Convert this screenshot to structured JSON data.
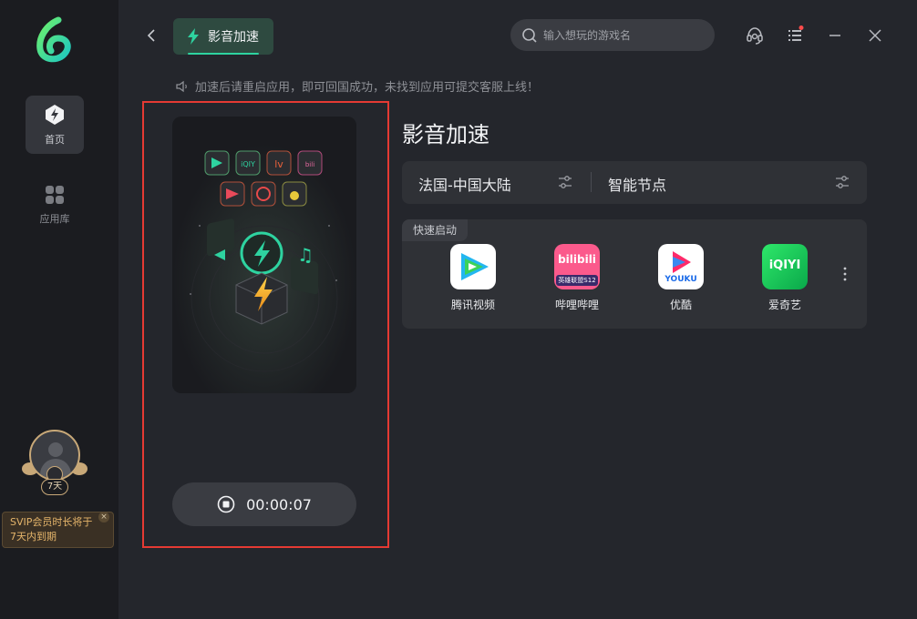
{
  "sidebar": {
    "items": [
      {
        "label": "首页",
        "icon": "lightning-home-icon",
        "active": true
      },
      {
        "label": "应用库",
        "icon": "grid-apps-icon",
        "active": false
      }
    ],
    "user": {
      "days_badge": "7天"
    },
    "vip_tip": {
      "line1": "SVIP会员时长将于",
      "line2": "7天内到期",
      "close": "×"
    }
  },
  "header": {
    "tab_label": "影音加速",
    "search_placeholder": "输入想玩的游戏名"
  },
  "notice": "加速后请重启应用，即可回国成功，未找到应用可提交客服上线！",
  "timer": "00:00:07",
  "main": {
    "title": "影音加速",
    "region": "法国-中国大陆",
    "node": "智能节点"
  },
  "quick_launch": {
    "tag": "快速启动",
    "apps": [
      {
        "name": "腾讯视频",
        "icon": "tencent-video-icon"
      },
      {
        "name": "哔哩哔哩",
        "icon": "bilibili-icon",
        "icon_text": "bilibili",
        "icon_subtext": "英雄联盟S12"
      },
      {
        "name": "优酷",
        "icon": "youku-icon",
        "icon_text": "YOUKU"
      },
      {
        "name": "爱奇艺",
        "icon": "iqiyi-icon",
        "icon_text": "iQIYI"
      }
    ]
  },
  "colors": {
    "accent": "#2ed3a0",
    "highlight_border": "#e53a33",
    "vip_gold": "#e4b46a"
  }
}
